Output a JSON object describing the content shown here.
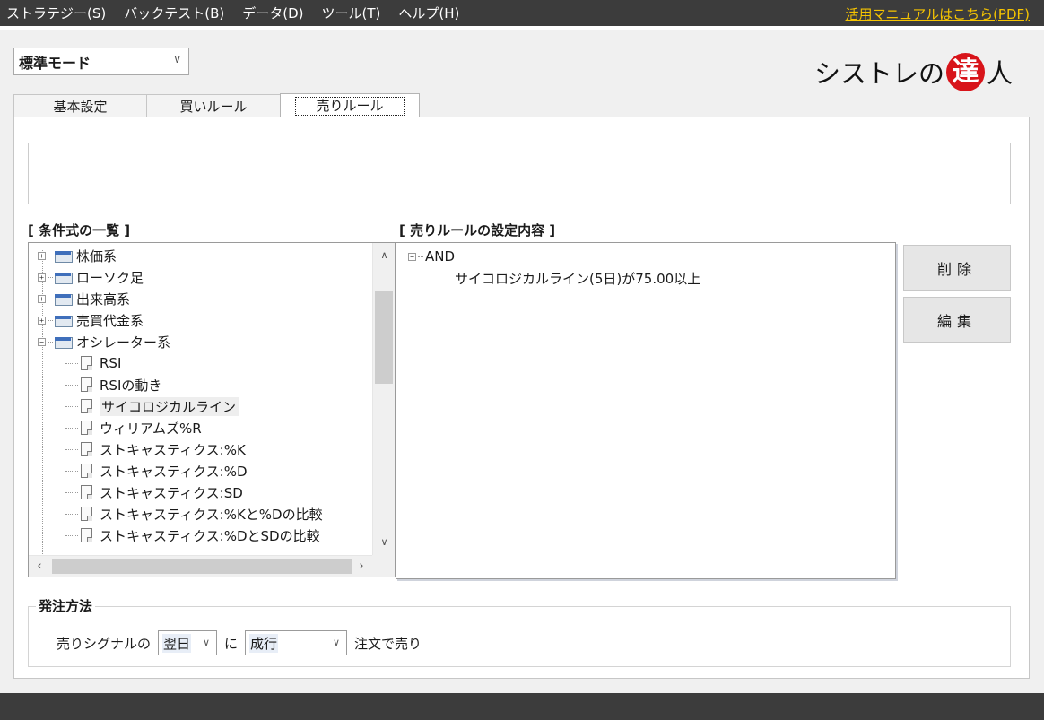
{
  "menu": {
    "items": [
      "ストラテジー(S)",
      "バックテスト(B)",
      "データ(D)",
      "ツール(T)",
      "ヘルプ(H)"
    ],
    "manual_link": "活用マニュアルはこちら(PDF)"
  },
  "mode": {
    "selected": "標準モード"
  },
  "logo": {
    "text_before": "シストレの",
    "seal_char": "達",
    "text_after": "人"
  },
  "tabs": [
    {
      "label": "基本設定"
    },
    {
      "label": "買いルール"
    },
    {
      "label": "売りルール",
      "active": true
    }
  ],
  "description": "",
  "condition_list": {
    "title": "[ 条件式の一覧 ]",
    "categories": [
      "株価系",
      "ローソク足",
      "出来高系",
      "売買代金系",
      "オシレーター系"
    ],
    "oscillator_children": [
      "RSI",
      "RSIの動き",
      "サイコロジカルライン",
      "ウィリアムズ%R",
      "ストキャスティクス:%K",
      "ストキャスティクス:%D",
      "ストキャスティクス:SD",
      "ストキャスティクス:%Kと%Dの比較",
      "ストキャスティクス:%DとSDの比較"
    ],
    "selected": "サイコロジカルライン"
  },
  "sell_rule": {
    "title": "[ 売りルールの設定内容 ]",
    "root": "AND",
    "conditions": [
      "サイコロジカルライン(5日)が75.00以上"
    ]
  },
  "buttons": {
    "delete": "削除",
    "edit": "編集"
  },
  "order": {
    "legend": "発注方法",
    "prefix": "売りシグナルの",
    "timing": "翌日",
    "connector": "に",
    "type": "成行",
    "suffix": "注文で売り"
  },
  "colors": {
    "menubar": "#3c3c3c",
    "link": "#f6c400",
    "seal": "#d8141a",
    "rule_branch": "#d02020"
  }
}
